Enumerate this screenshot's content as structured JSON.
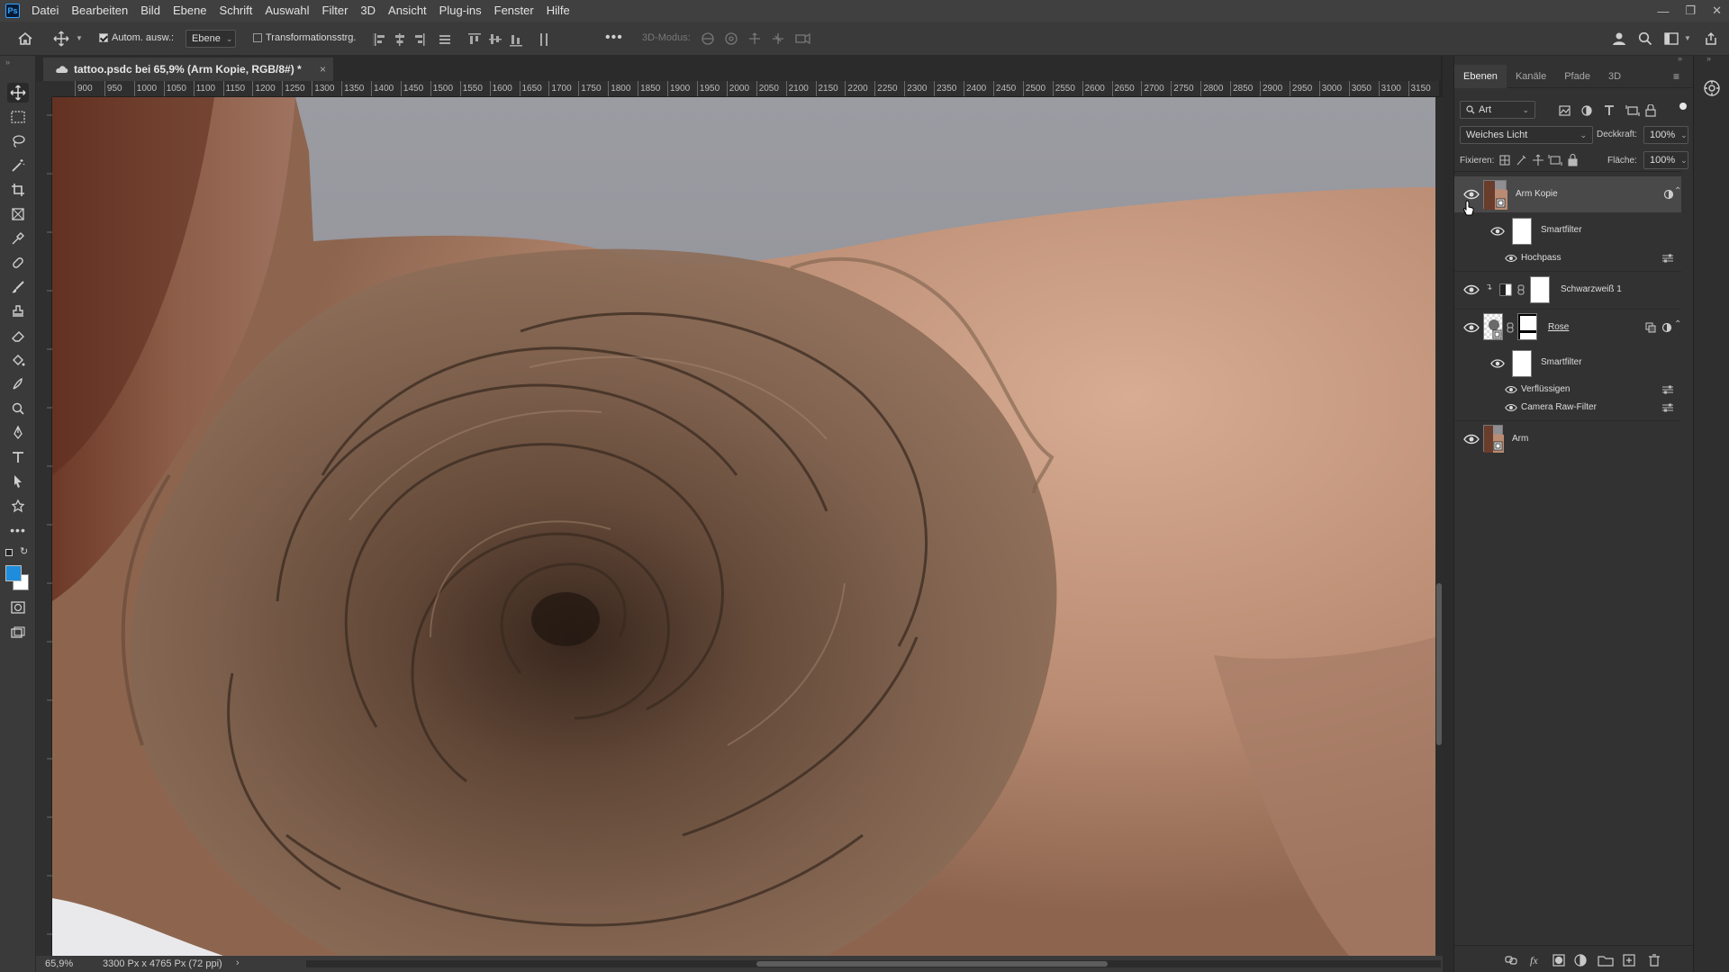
{
  "app": {
    "logo_text": "Ps"
  },
  "menu": [
    "Datei",
    "Bearbeiten",
    "Bild",
    "Ebene",
    "Schrift",
    "Auswahl",
    "Filter",
    "3D",
    "Ansicht",
    "Plug-ins",
    "Fenster",
    "Hilfe"
  ],
  "options": {
    "auto_select_label": "Autom. ausw.:",
    "auto_select_checked": true,
    "target_value": "Ebene",
    "transform_label": "Transformationsstrg.",
    "transform_checked": false,
    "mode_3d_label": "3D-Modus:"
  },
  "document": {
    "tab_title": "tattoo.psdc bei 65,9% (Arm Kopie, RGB/8#) *",
    "close_glyph": "×"
  },
  "ruler": {
    "labels": [
      "900",
      "950",
      "1000",
      "1050",
      "1100",
      "1150",
      "1200",
      "1250",
      "1300",
      "1350",
      "1400",
      "1450",
      "1500",
      "1550",
      "1600",
      "1650",
      "1700",
      "1750",
      "1800",
      "1850",
      "1900",
      "1950",
      "2000",
      "2050",
      "2100",
      "2150",
      "2200",
      "2250",
      "2300",
      "2350",
      "2400",
      "2450",
      "2500",
      "2550",
      "2600",
      "2650",
      "2700",
      "2750",
      "2800",
      "2850",
      "2900",
      "2950",
      "3000",
      "3050",
      "3100",
      "3150"
    ]
  },
  "status": {
    "zoom": "65,9%",
    "size": "3300 Px x 4765 Px (72 ppi)",
    "arrow": "›"
  },
  "layers_panel": {
    "tabs": [
      {
        "label": "Ebenen",
        "active": true
      },
      {
        "label": "Kanäle",
        "active": false
      },
      {
        "label": "Pfade",
        "active": false
      },
      {
        "label": "3D",
        "active": false
      }
    ],
    "filter_kind": "Art",
    "blend_mode": "Weiches Licht",
    "opacity_label": "Deckkraft:",
    "opacity_value": "100%",
    "lock_label": "Fixieren:",
    "fill_label": "Fläche:",
    "fill_value": "100%",
    "layers": [
      {
        "name": "Arm Kopie",
        "type": "smart-object",
        "visible": true,
        "selected": true
      },
      {
        "name": "Smartfilter",
        "type": "smart-filter-mask",
        "visible": true
      },
      {
        "name": "Hochpass",
        "type": "filter",
        "visible": true
      },
      {
        "name": "Schwarzweiß 1",
        "type": "adjustment",
        "visible": true
      },
      {
        "name": "Rose",
        "type": "smart-object",
        "visible": true
      },
      {
        "name": "Smartfilter",
        "type": "smart-filter-mask",
        "visible": true
      },
      {
        "name": "Verflüssigen",
        "type": "filter",
        "visible": true
      },
      {
        "name": "Camera Raw-Filter",
        "type": "filter",
        "visible": true
      },
      {
        "name": "Arm",
        "type": "smart-object",
        "visible": true
      }
    ]
  },
  "colors": {
    "foreground": "#1e8ddc",
    "background": "#ffffff",
    "accent": "#31a8ff"
  }
}
